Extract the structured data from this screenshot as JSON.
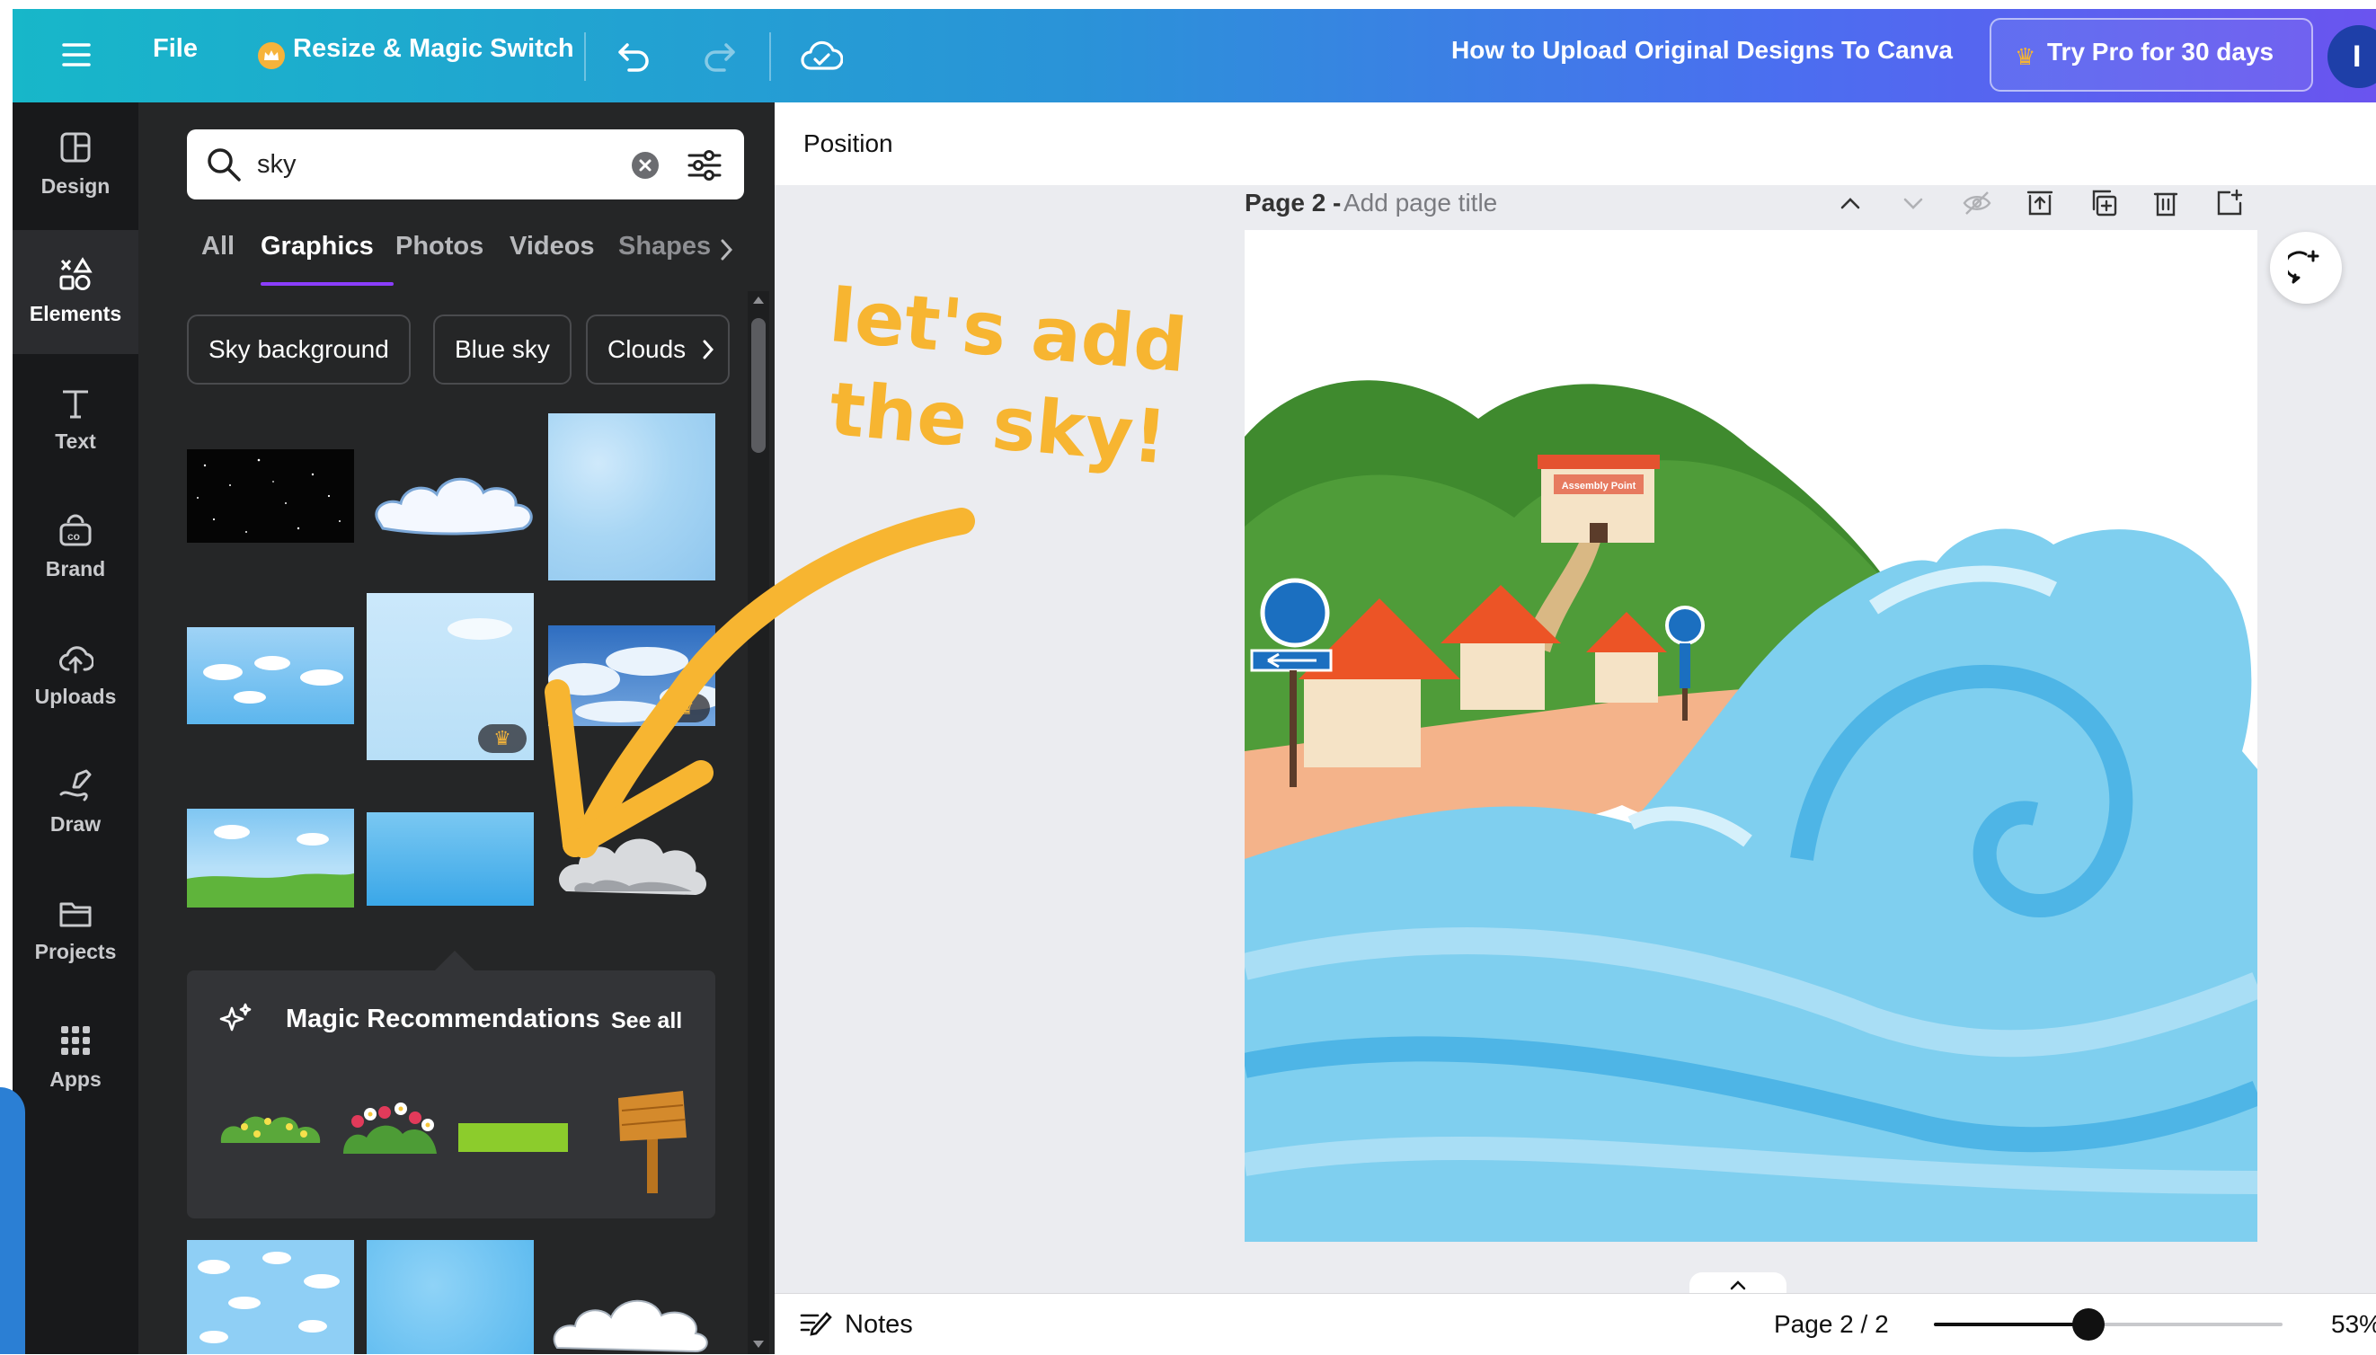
{
  "topbar": {
    "file_label": "File",
    "resize_label": "Resize & Magic Switch",
    "doc_title": "How to Upload Original Designs To Canva",
    "pro_label": "Try Pro for 30 days",
    "avatar_initial": "I",
    "icons": [
      "menu-icon",
      "crown-icon",
      "undo-icon",
      "redo-icon",
      "cloud-saved-icon"
    ]
  },
  "rail": {
    "items": [
      {
        "label": "Design",
        "icon": "design-icon"
      },
      {
        "label": "Elements",
        "icon": "elements-icon"
      },
      {
        "label": "Text",
        "icon": "text-icon"
      },
      {
        "label": "Brand",
        "icon": "brand-icon"
      },
      {
        "label": "Uploads",
        "icon": "uploads-icon"
      },
      {
        "label": "Draw",
        "icon": "draw-icon"
      },
      {
        "label": "Projects",
        "icon": "projects-icon"
      },
      {
        "label": "Apps",
        "icon": "apps-icon"
      }
    ]
  },
  "panel": {
    "search_value": "sky",
    "tabs": [
      "All",
      "Graphics",
      "Photos",
      "Videos",
      "Shapes"
    ],
    "active_tab": "Graphics",
    "chips": [
      "Sky background",
      "Blue sky",
      "Clouds"
    ],
    "magic_title": "Magic Recommendations",
    "see_all": "See all"
  },
  "canvas": {
    "position_label": "Position",
    "page_label": "Page 2 -",
    "page_title_placeholder": "Add page title",
    "sign_text": "Assembly Point"
  },
  "bottom": {
    "notes_label": "Notes",
    "page_counter": "Page 2 / 2",
    "zoom": "53%"
  },
  "annotation": {
    "line1": "let's add",
    "line2": "the sky!"
  },
  "colors": {
    "accent": "#8b3dff",
    "annotation": "#f7b531",
    "panel_bg": "#252627",
    "rail_bg": "#18191b"
  }
}
